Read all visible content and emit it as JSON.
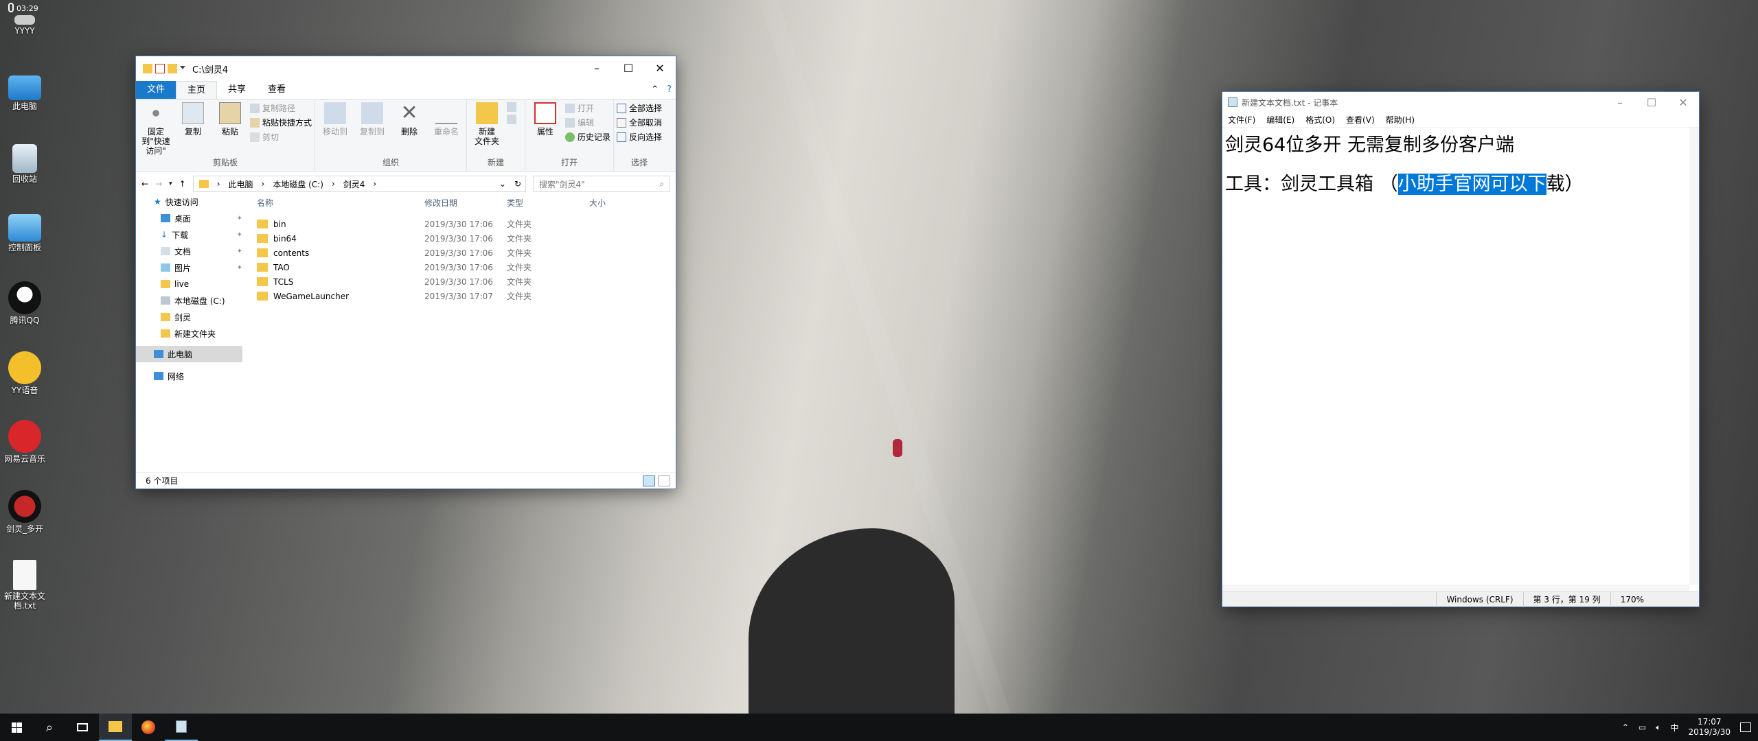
{
  "clock_top": "03:29",
  "desktop_icons": [
    {
      "name": "YYYY",
      "icon": "app-icon"
    },
    {
      "name": "此电脑",
      "icon": "this-pc-icon"
    },
    {
      "name": "回收站",
      "icon": "recycle-bin-icon"
    },
    {
      "name": "控制面板",
      "icon": "control-panel-icon"
    },
    {
      "name": "腾讯QQ",
      "icon": "qq-icon"
    },
    {
      "name": "YY语音",
      "icon": "yy-icon"
    },
    {
      "name": "网易云音乐",
      "icon": "netease-music-icon"
    },
    {
      "name": "剑灵_多开",
      "icon": "blade-soul-icon"
    },
    {
      "name": "新建文本文档.txt",
      "icon": "text-file-icon"
    }
  ],
  "explorer": {
    "title": "C:\\剑灵4",
    "tabs": [
      "文件",
      "主页",
      "共享",
      "查看"
    ],
    "ribbon": {
      "clipboard": {
        "name": "剪贴板",
        "pin": "固定到\"快速访问\"",
        "copy": "复制",
        "paste": "粘贴",
        "copy_path": "复制路径",
        "paste_shortcut": "粘贴快捷方式",
        "cut": "剪切"
      },
      "organize": {
        "name": "组织",
        "move_to": "移动到",
        "copy_to": "复制到",
        "delete": "删除",
        "rename": "重命名"
      },
      "new": {
        "name": "新建",
        "new_folder": "新建\n文件夹"
      },
      "open": {
        "name": "打开",
        "properties": "属性",
        "open": "打开",
        "edit": "编辑",
        "history": "历史记录"
      },
      "select": {
        "name": "选择",
        "select_all": "全部选择",
        "select_none": "全部取消",
        "invert": "反向选择"
      }
    },
    "breadcrumb": [
      "此电脑",
      "本地磁盘 (C:)",
      "剑灵4"
    ],
    "search_placeholder": "搜索\"剑灵4\"",
    "nav": [
      {
        "label": "快速访问",
        "icon": "star-icon"
      },
      {
        "label": "桌面",
        "icon": "desktop-folder-icon"
      },
      {
        "label": "下载",
        "icon": "download-icon"
      },
      {
        "label": "文档",
        "icon": "document-icon"
      },
      {
        "label": "图片",
        "icon": "picture-icon"
      },
      {
        "label": "live",
        "icon": "folder-icon"
      },
      {
        "label": "本地磁盘 (C:)",
        "icon": "drive-icon"
      },
      {
        "label": "剑灵",
        "icon": "folder-icon"
      },
      {
        "label": "新建文件夹",
        "icon": "folder-icon"
      },
      {
        "label": "此电脑",
        "icon": "this-pc-icon"
      },
      {
        "label": "网络",
        "icon": "network-icon"
      }
    ],
    "columns": [
      "名称",
      "修改日期",
      "类型",
      "大小"
    ],
    "files": [
      {
        "name": "bin",
        "date": "2019/3/30 17:06",
        "type": "文件夹"
      },
      {
        "name": "bin64",
        "date": "2019/3/30 17:06",
        "type": "文件夹"
      },
      {
        "name": "contents",
        "date": "2019/3/30 17:06",
        "type": "文件夹"
      },
      {
        "name": "TAO",
        "date": "2019/3/30 17:06",
        "type": "文件夹"
      },
      {
        "name": "TCLS",
        "date": "2019/3/30 17:06",
        "type": "文件夹"
      },
      {
        "name": "WeGameLauncher",
        "date": "2019/3/30 17:07",
        "type": "文件夹"
      }
    ],
    "status": "6 个项目"
  },
  "notepad": {
    "title": "新建文本文档.txt - 记事本",
    "menu": [
      "文件(F)",
      "编辑(E)",
      "格式(O)",
      "查看(V)",
      "帮助(H)"
    ],
    "line1": "剑灵64位多开 无需复制多份客户端",
    "line3_before": "工具：剑灵工具箱  （",
    "line3_selected": "小助手官网可以下",
    "line3_after": "载）",
    "status_encoding": "Windows (CRLF)",
    "status_position": "第 3 行，第 19 列",
    "status_zoom": "170%"
  },
  "taskbar": {
    "time": "17:07",
    "date": "2019/3/30",
    "ime": "中"
  },
  "colors": {
    "accent": "#1979ca",
    "selection": "#0078d7",
    "folder": "#f4c64a",
    "taskbar": "#101214"
  }
}
